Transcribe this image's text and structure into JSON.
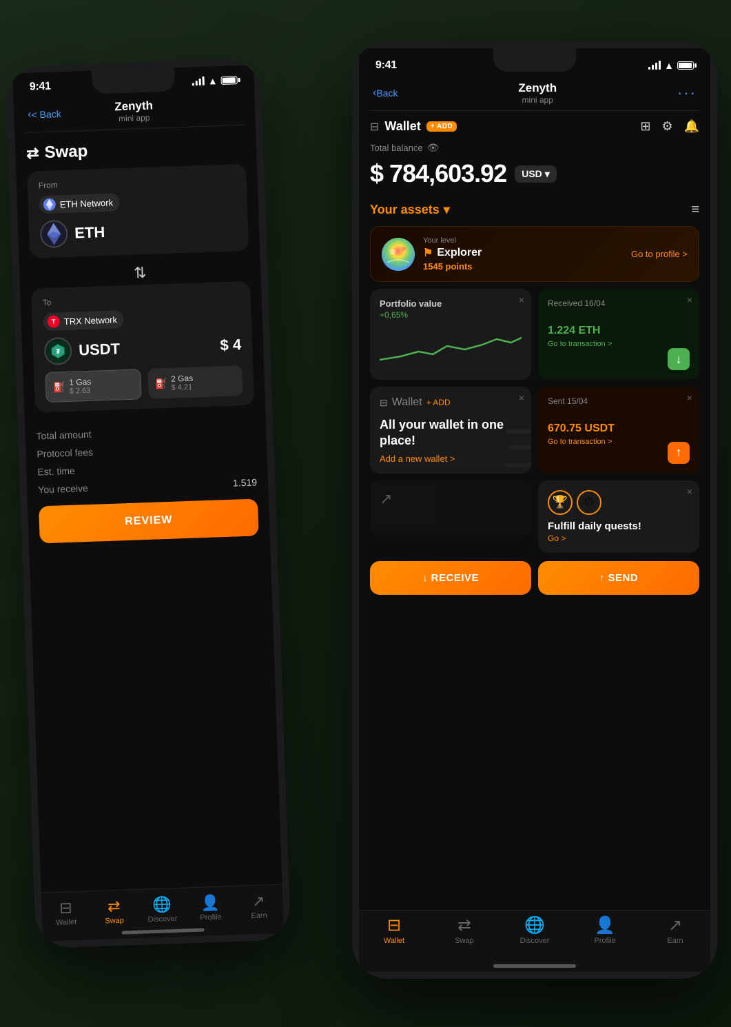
{
  "scene": {
    "background": "#1a2a1a"
  },
  "back_phone": {
    "status_bar": {
      "time": "9:41"
    },
    "nav": {
      "back_label": "< Back",
      "title": "Zenyth",
      "subtitle": "mini app"
    },
    "swap": {
      "title": "Swap",
      "from_label": "From",
      "from_network": "ETH Network",
      "from_token": "ETH",
      "to_label": "To",
      "to_network": "TRX Network",
      "to_token": "USDT",
      "to_amount": "$ 4",
      "gas_options": [
        {
          "label": "1 Gas",
          "price": "$ 2.63",
          "active": true
        },
        {
          "label": "2 Gas",
          "price": "$ 4.21",
          "active": false
        }
      ],
      "total_amount_label": "Total amount",
      "protocol_fees_label": "Protocol fees",
      "est_time_label": "Est. time",
      "you_receive_label": "You receive",
      "you_receive_value": "1.519",
      "review_btn": "REVIEW"
    },
    "bottom_nav": [
      {
        "label": "Wallet",
        "icon": "⊟",
        "active": false
      },
      {
        "label": "Swap",
        "icon": "⇄",
        "active": true
      },
      {
        "label": "Discover",
        "icon": "◉",
        "active": false
      },
      {
        "label": "Profile",
        "icon": "♟",
        "active": false
      },
      {
        "label": "Earn",
        "icon": "↗",
        "active": false
      }
    ]
  },
  "front_phone": {
    "status_bar": {
      "time": "9:41"
    },
    "nav": {
      "back_label": "< Back",
      "title": "Zenyth",
      "subtitle": "mini app"
    },
    "wallet": {
      "title": "Wallet",
      "add_label": "+ ADD",
      "total_balance_label": "Total balance",
      "balance": "$ 784,603.92",
      "currency": "USD",
      "assets_title": "Your assets",
      "level_label": "Your level",
      "level_name": "Explorer",
      "level_points": "1545 points",
      "go_to_profile": "Go to profile >",
      "portfolio_title": "Portfolio value",
      "portfolio_change": "+0,65%",
      "received_date": "Received 16/04",
      "received_amount": "1.224 ETH",
      "received_link": "Go to transaction >",
      "sent_date": "Sent 15/04",
      "sent_amount": "670.75 USDT",
      "sent_link": "Go to transaction >",
      "quest_title": "Fulfill daily quests!",
      "quest_link": "Go >",
      "wallet_add_title": "Wallet",
      "wallet_add_text": "All your wallet in one place!",
      "wallet_add_link": "Add a new wallet >",
      "receive_btn": "↓ RECEIVE",
      "send_btn": "↑ SEND"
    },
    "bottom_nav": [
      {
        "label": "Wallet",
        "icon": "⊟",
        "active": true
      },
      {
        "label": "Swap",
        "icon": "⇄",
        "active": false
      },
      {
        "label": "Discover",
        "icon": "◉",
        "active": false
      },
      {
        "label": "Profile",
        "icon": "♟",
        "active": false
      },
      {
        "label": "Earn",
        "icon": "↗",
        "active": false
      }
    ]
  }
}
